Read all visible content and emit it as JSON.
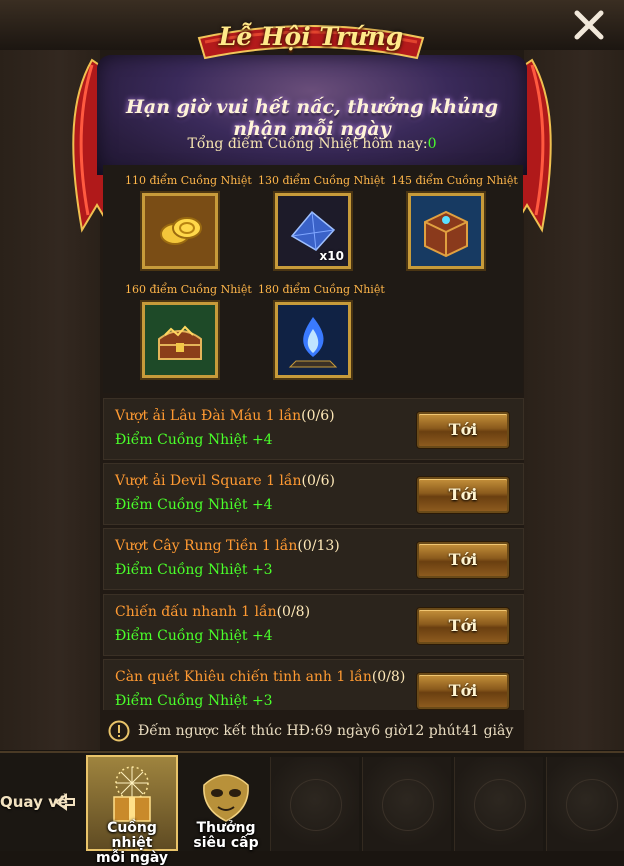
{
  "header": {
    "title": "Lễ Hội Trứng",
    "subtitle": "Hạn giờ vui hết nấc, thưởng khủng nhận mỗi ngày",
    "total_label": "Tổng điểm Cuồng Nhiệt hôm nay:",
    "total_value": "0"
  },
  "rewards": [
    {
      "label": "110 điểm Cuồng Nhiệt",
      "icon": "gold-coins-icon",
      "qty": ""
    },
    {
      "label": "130 điểm Cuồng Nhiệt",
      "icon": "blue-crystal-icon",
      "qty": "x10"
    },
    {
      "label": "145 điểm Cuồng Nhiệt",
      "icon": "mystery-box-icon",
      "qty": ""
    },
    {
      "label": "160 điểm Cuồng Nhiệt",
      "icon": "treasure-chest-icon",
      "qty": ""
    },
    {
      "label": "180 điểm Cuồng Nhiệt",
      "icon": "blue-flame-icon",
      "qty": ""
    }
  ],
  "tasks": [
    {
      "title": "Vượt ải Lâu Đài Máu 1 lần",
      "count": "(0/6)",
      "points": "Điểm Cuồng Nhiệt +4",
      "button": "Tới"
    },
    {
      "title": "Vượt ải Devil Square 1 lần",
      "count": "(0/6)",
      "points": "Điểm Cuồng Nhiệt +4",
      "button": "Tới"
    },
    {
      "title": "Vượt Cây Rung Tiền 1 lần",
      "count": "(0/13)",
      "points": "Điểm Cuồng Nhiệt +3",
      "button": "Tới"
    },
    {
      "title": "Chiến đấu nhanh 1 lần",
      "count": "(0/8)",
      "points": "Điểm Cuồng Nhiệt +4",
      "button": "Tới"
    },
    {
      "title": "Càn quét Khiêu chiến tinh anh 1 lần",
      "count": "(0/8)",
      "points": "Điểm Cuồng Nhiệt +3",
      "button": "Tới"
    }
  ],
  "countdown": {
    "text": "Đếm ngược kết thúc HĐ:69 ngày6 giờ12 phút41 giây"
  },
  "bottom_nav": {
    "back": "Quay về",
    "tabs": [
      {
        "label_1": "Cuồng nhiệt",
        "label_2": "mỗi ngày",
        "active": true
      },
      {
        "label_1": "Thưởng",
        "label_2": "siêu cấp",
        "active": false
      }
    ]
  },
  "colors": {
    "orange_text": "#ff9a32",
    "green_text": "#4aff2a",
    "gold_border": "#c79b3a",
    "header_purple": "#3a2a5a"
  }
}
